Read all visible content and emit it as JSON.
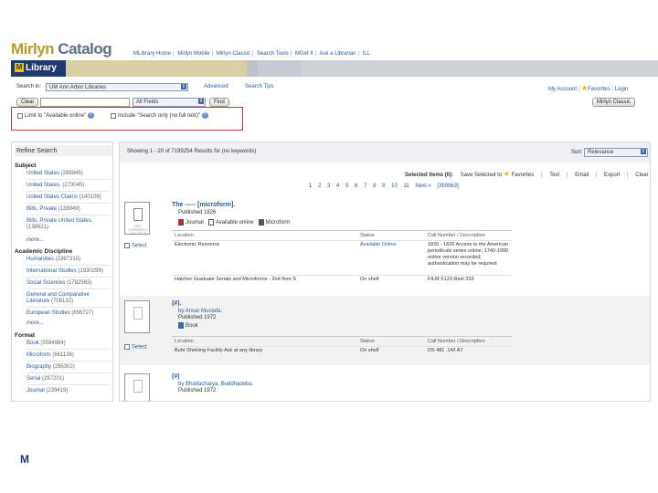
{
  "header": {
    "logo_mirlyn": "Mirlyn",
    "logo_catalog": "Catalog",
    "mlibrary": "Library",
    "mlibrary_mark": "M",
    "nav": [
      "MLibrary Home",
      "Mirlyn Mobile",
      "Mirlyn Classic",
      "Search Tools",
      "MGet It",
      "Ask a Librarian",
      "ILL"
    ],
    "account": "My Account",
    "favorites": "Favorites",
    "login": "Login",
    "mirlyn_classic_btn": "Mirlyn Classic"
  },
  "search": {
    "search_in_label": "Search in:",
    "search_in_value": "UM Ann Arbor Libraries",
    "advanced": "Advanced",
    "search_tips": "Search Tips",
    "clear_btn": "Clear",
    "field_value": "All Fields",
    "find_btn": "Find",
    "limit_available": "Limit to \"Available online\"",
    "include_search_only": "Include \"Search only (no full text)\"",
    "help": "?"
  },
  "sidebar": {
    "title": "Refine Search",
    "subject_heading": "Subject",
    "subject_items": [
      {
        "label": "United States",
        "count": "(298845)"
      },
      {
        "label": "United States.",
        "count": "(273045)"
      },
      {
        "label": "United States Claims",
        "count": "(140108)"
      },
      {
        "label": "Bills, Private",
        "count": "(138949)"
      },
      {
        "label": "Bills, Private United States.",
        "count": "(138921)"
      }
    ],
    "more1": "more...",
    "discipline_heading": "Academic Discipline",
    "discipline_items": [
      {
        "label": "Humanities",
        "count": "(2387315)"
      },
      {
        "label": "International Studies",
        "count": "(1930299)"
      },
      {
        "label": "Social Sciences",
        "count": "(1782563)"
      },
      {
        "label": "General and Comparative Literature",
        "count": "(708132)"
      },
      {
        "label": "European Studies",
        "count": "(656727)"
      }
    ],
    "more2": "more...",
    "format_heading": "Format",
    "format_items": [
      {
        "label": "Book",
        "count": "(5594984)"
      },
      {
        "label": "Microform",
        "count": "(661136)"
      },
      {
        "label": "Biography",
        "count": "(295302)"
      },
      {
        "label": "Serial",
        "count": "(287201)"
      },
      {
        "label": "Journal",
        "count": "(239419)"
      }
    ]
  },
  "results": {
    "showing": "Showing 1 - 20 of 7199254 Results for (no keywords)",
    "sort_label": "Sort",
    "sort_value": "Relevance",
    "selected_items": "Selected items (0):",
    "save_selected": "Save Selected to",
    "favorites": "Favorites",
    "actions": [
      "Text",
      "Email",
      "Export",
      "Clear"
    ],
    "pages": [
      "1",
      "2",
      "3",
      "4",
      "5",
      "6",
      "7",
      "8",
      "9",
      "10",
      "11"
    ],
    "next": "Next »",
    "last": "[359963]",
    "select_label": "Select",
    "col_location": "Location",
    "col_status": "Status",
    "col_call": "Call Number / Description",
    "thumb_text": "NOT CURRENTLY AVAILABLE",
    "records": [
      {
        "title": "The ----- [microform].",
        "published": "Published 1826",
        "formats": [
          "Journal",
          "Available online",
          "Microform"
        ],
        "holdings": [
          {
            "location": "Electronic Resource",
            "status": "Available Online",
            "call": "1826 - 1826 Access to the American periodicals series online, 1740-1900 online version recorded; authentication may be required"
          },
          {
            "location": "Hatcher Graduate Serials and Microforms - 2nd floor S",
            "status": "On shelf",
            "call": "FILM X123 Reel 333"
          }
        ]
      },
      {
        "title": "(#).",
        "by": "by Anvar Mustafa.",
        "published": "Published 1972",
        "formats": [
          "Book"
        ],
        "holdings": [
          {
            "location": "Buhr Shelving Facility Ask at any library",
            "status": "On shelf",
            "call": "DS 481 .142 A7"
          }
        ]
      },
      {
        "title": "(#)",
        "by": "by Bhattacharya, Buddhadeba.",
        "published": "Published 1972"
      }
    ]
  },
  "footer": {
    "mark": "M"
  },
  "colors": {
    "brand_navy": "#1f3a6e",
    "brand_maize": "#f2c200",
    "link": "#2a5a9c",
    "highlight_box": "#c43a3a"
  }
}
